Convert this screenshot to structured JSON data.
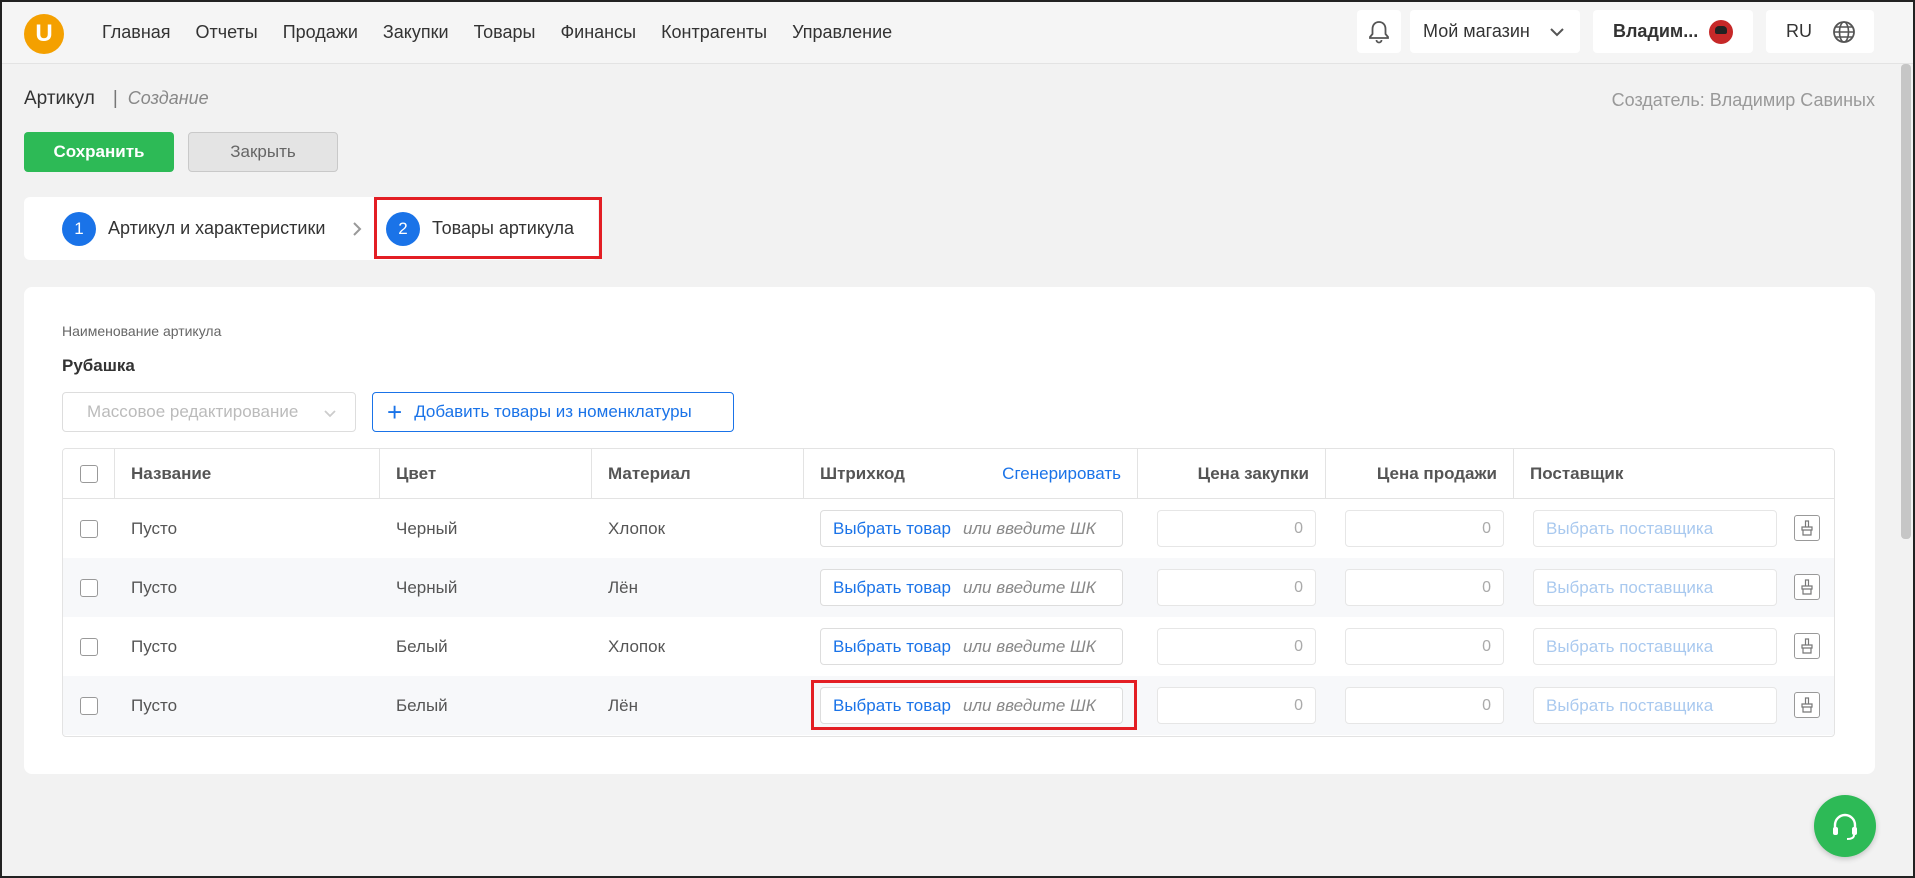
{
  "app": {
    "logo": "U"
  },
  "nav": [
    "Главная",
    "Отчеты",
    "Продажи",
    "Закупки",
    "Товары",
    "Финансы",
    "Контрагенты",
    "Управление"
  ],
  "topbar": {
    "store": "Мой магазин",
    "user": "Владим...",
    "lang": "RU"
  },
  "header": {
    "title": "Артикул",
    "separator": "|",
    "subtitle": "Создание",
    "creator": "Создатель: Владимир Савиных"
  },
  "actions": {
    "save": "Сохранить",
    "close": "Закрыть"
  },
  "steps": [
    {
      "num": "1",
      "label": "Артикул и характеристики"
    },
    {
      "num": "2",
      "label": "Товары артикула"
    }
  ],
  "form": {
    "name_label": "Наименование артикула",
    "name_value": "Рубашка",
    "mass_edit": "Массовое редактирование",
    "add_button": "Добавить товары из номенклатуры"
  },
  "table": {
    "headers": {
      "name": "Название",
      "color": "Цвет",
      "material": "Материал",
      "barcode": "Штрихкод",
      "generate": "Сгенерировать",
      "purchase": "Цена закупки",
      "sale": "Цена продажи",
      "supplier": "Поставщик"
    },
    "rows": [
      {
        "name": "Пусто",
        "color": "Черный",
        "material": "Хлопок",
        "pick": "Выбрать товар",
        "or": "или введите ШК",
        "purchase": "0",
        "sale": "0",
        "supplier": "Выбрать поставщика"
      },
      {
        "name": "Пусто",
        "color": "Черный",
        "material": "Лён",
        "pick": "Выбрать товар",
        "or": "или введите ШК",
        "purchase": "0",
        "sale": "0",
        "supplier": "Выбрать поставщика"
      },
      {
        "name": "Пусто",
        "color": "Белый",
        "material": "Хлопок",
        "pick": "Выбрать товар",
        "or": "или введите ШК",
        "purchase": "0",
        "sale": "0",
        "supplier": "Выбрать поставщика"
      },
      {
        "name": "Пусто",
        "color": "Белый",
        "material": "Лён",
        "pick": "Выбрать товар",
        "or": "или введите ШК",
        "purchase": "0",
        "sale": "0",
        "supplier": "Выбрать поставщика"
      }
    ]
  },
  "icons": [
    "bell-icon",
    "chevron-down-icon",
    "globe-icon",
    "chevron-right-icon",
    "plus-icon",
    "broom-icon",
    "headset-icon"
  ],
  "colors": {
    "accent": "#1a73e8",
    "success": "#2dba56",
    "highlight": "#e31e24",
    "logo": "#f4a000"
  }
}
